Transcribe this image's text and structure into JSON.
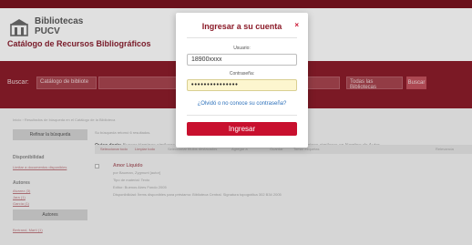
{
  "header": {
    "logo_line1": "Bibliotecas",
    "logo_line2": "PUCV",
    "catalog_title": "Catálogo de Recursos Bibliográficos"
  },
  "search": {
    "label": "Buscar:",
    "type_select": "Catálogo de bibliote",
    "library_select": "Todas las Bibliotecas",
    "go": "Buscar"
  },
  "content": {
    "breadcrumb": "Inicio › Resultados de búsqueda en el Catálogo de la Biblioteca",
    "refine_button": "Refinar la búsqueda",
    "result_note": "Su búsqueda retornó 6 resultados.",
    "quiso_decir_label": "Quiso decir:",
    "quiso_decir_text": "Buscar términos similares en el campo Materia · Buscar palabras relacionadas · Buscar términos similares en Nombre de Autor",
    "sidebar": {
      "availability_head": "Disponibilidad",
      "availability_link": "Limitar a documentos disponibles",
      "authors_head": "Autores",
      "authors": [
        "Alvarez (3)",
        "Jara (1)",
        "García (1)"
      ],
      "more_button": "Autores",
      "last": "Bertrand, Martí (1)"
    },
    "toolbar": {
      "select_all": "Seleccionar todo",
      "clear_all": "Limpiar todo",
      "highlight": "Seleccionar títulos destacados",
      "add_to": "Agregar a",
      "save": "Guardar",
      "tag": "Tomar etiquetas",
      "relevance": "Relevancia"
    },
    "result": {
      "title": "Amor Líquido",
      "author": "por Bauman, Zygmunt [autor]",
      "type": "Tipo de material: Texto",
      "editor": "Editor: Buenos Aires Fondo 2005",
      "availability": "Disponibilidad: Ítems disponibles para préstamo: Biblioteca Central. Signatura topográfica 302 B34 2005"
    }
  },
  "login": {
    "title": "Ingresar a su cuenta",
    "close_symbol": "×",
    "user_label": "Usuario:",
    "user_value": "18900xxxx",
    "pass_label": "Contraseña:",
    "pass_value": "•••••••••••••••",
    "forgot": "¿Olvidó o no conoce su contraseña?",
    "submit": "Ingresar"
  },
  "colors": {
    "brand": "#8c1d2b",
    "accent": "#c8102e",
    "link": "#2a6fba"
  }
}
